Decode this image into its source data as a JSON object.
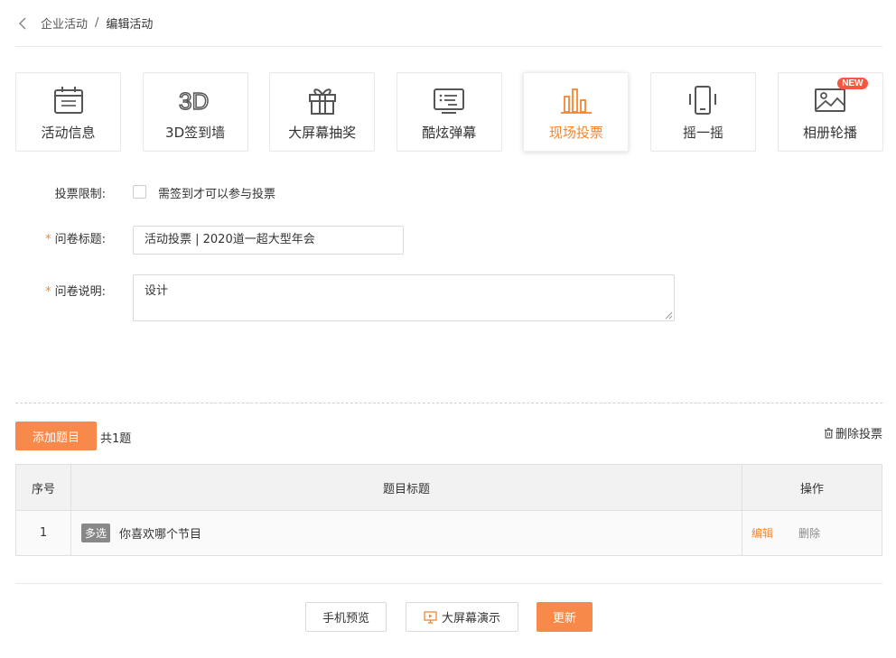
{
  "breadcrumb": {
    "parent": "企业活动",
    "separator": "/",
    "current": "编辑活动"
  },
  "tabs": [
    {
      "label": "活动信息",
      "icon": "calendar-icon"
    },
    {
      "label": "3D签到墙",
      "icon": "3d-icon"
    },
    {
      "label": "大屏幕抽奖",
      "icon": "gift-icon"
    },
    {
      "label": "酷炫弹幕",
      "icon": "danmaku-icon"
    },
    {
      "label": "现场投票",
      "icon": "bar-chart-icon",
      "active": true
    },
    {
      "label": "摇一摇",
      "icon": "phone-shake-icon"
    },
    {
      "label": "相册轮播",
      "icon": "image-icon",
      "badge": "NEW"
    }
  ],
  "form": {
    "restriction_label": "投票限制:",
    "restriction_checkbox_label": "需签到才可以参与投票",
    "title_label": "问卷标题:",
    "title_value": "活动投票 | 2020道一超大型年会",
    "desc_label": "问卷说明:",
    "desc_value": "设计",
    "required_mark": "*"
  },
  "toolbar": {
    "add_button": "添加题目",
    "count_text": "共1题",
    "delete_vote": "删除投票"
  },
  "table": {
    "headers": [
      "序号",
      "题目标题",
      "操作"
    ],
    "rows": [
      {
        "index": "1",
        "type": "多选",
        "title": "你喜欢哪个节目",
        "edit": "编辑",
        "delete": "删除"
      }
    ]
  },
  "footer": {
    "preview": "手机预览",
    "screen_demo": "大屏幕演示",
    "update": "更新"
  },
  "colors": {
    "accent": "#f5862e",
    "button_orange": "#f7894a",
    "badge_red": "#f25a3d"
  }
}
